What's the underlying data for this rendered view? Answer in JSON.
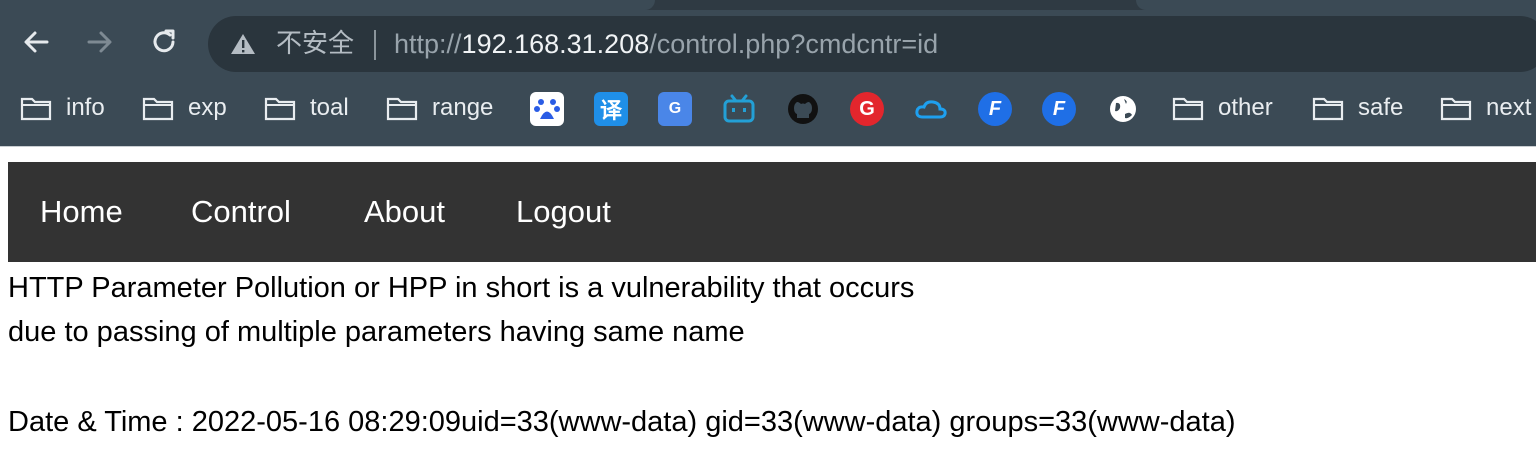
{
  "browser": {
    "security_label": "不安全",
    "url": {
      "scheme": "http://",
      "host": "192.168.31.208",
      "path": "/control.php?cmdcntr=id"
    },
    "bookmarks": {
      "folders": [
        "info",
        "exp",
        "toal",
        "range",
        "other",
        "safe",
        "next"
      ],
      "icons": [
        {
          "name": "baidu-icon",
          "color": "#2a5ce5"
        },
        {
          "name": "translate-icon",
          "color": "#1f8fe8"
        },
        {
          "name": "google-translate-icon",
          "color": "#4a86e8"
        },
        {
          "name": "bilibili-icon",
          "color": "#23a0d6"
        },
        {
          "name": "github-icon",
          "color": "#111111"
        },
        {
          "name": "g-logo-icon",
          "color": "#e3262d"
        },
        {
          "name": "cloud-icon",
          "color": "#1ea0f0"
        },
        {
          "name": "f-logo-icon",
          "color": "#1f6fe6"
        },
        {
          "name": "f-logo-icon-2",
          "color": "#1f6fe6"
        },
        {
          "name": "globe-icon",
          "color": "#ffffff"
        }
      ]
    }
  },
  "navbar": {
    "items": [
      "Home",
      "Control",
      "About",
      "Logout"
    ]
  },
  "content": {
    "line1": "HTTP Parameter Pollution or HPP in short is a vulnerability that occurs",
    "line2": "due to passing of multiple parameters having same name",
    "output": "Date & Time : 2022-05-16 08:29:09uid=33(www-data) gid=33(www-data) groups=33(www-data)"
  }
}
